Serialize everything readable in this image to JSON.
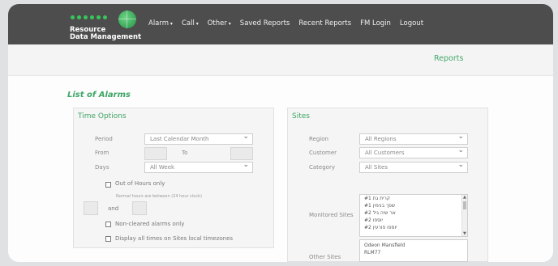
{
  "brand": {
    "line1": "Resource",
    "line2": "Data Management"
  },
  "nav": {
    "items": [
      {
        "label": "Alarm"
      },
      {
        "label": "Call"
      },
      {
        "label": "Other"
      },
      {
        "label": "Saved Reports"
      },
      {
        "label": "Recent Reports"
      },
      {
        "label": "FM Login"
      },
      {
        "label": "Logout"
      }
    ]
  },
  "subheader": {
    "reports": "Reports"
  },
  "page": {
    "title": "List of Alarms"
  },
  "time_options": {
    "title": "Time Options",
    "period_label": "Period",
    "period_value": "Last Calendar Month",
    "from_label": "From",
    "to_label": "To",
    "days_label": "Days",
    "days_value": "All Week",
    "out_of_hours": "Out of Hours only",
    "normal_hours_note": "Normal hours are between (24 hour clock)",
    "and_label": "and",
    "non_cleared": "Non-cleared alarms only",
    "display_times": "Display all times on Sites local timezones"
  },
  "sites": {
    "title": "Sites",
    "region_label": "Region",
    "region_value": "All Regions",
    "customer_label": "Customer",
    "customer_value": "All Customers",
    "category_label": "Category",
    "category_value": "All Sites",
    "monitored_label": "Monitored Sites",
    "monitored_items": [
      "קרית גת #1",
      "שפך בנימין #1",
      "אר שיה גיל #2",
      "יוספו #2",
      "יוספו פורעין #2"
    ],
    "other_label": "Other Sites",
    "other_items": [
      "Odeon Mansfield",
      "RLM77"
    ]
  }
}
